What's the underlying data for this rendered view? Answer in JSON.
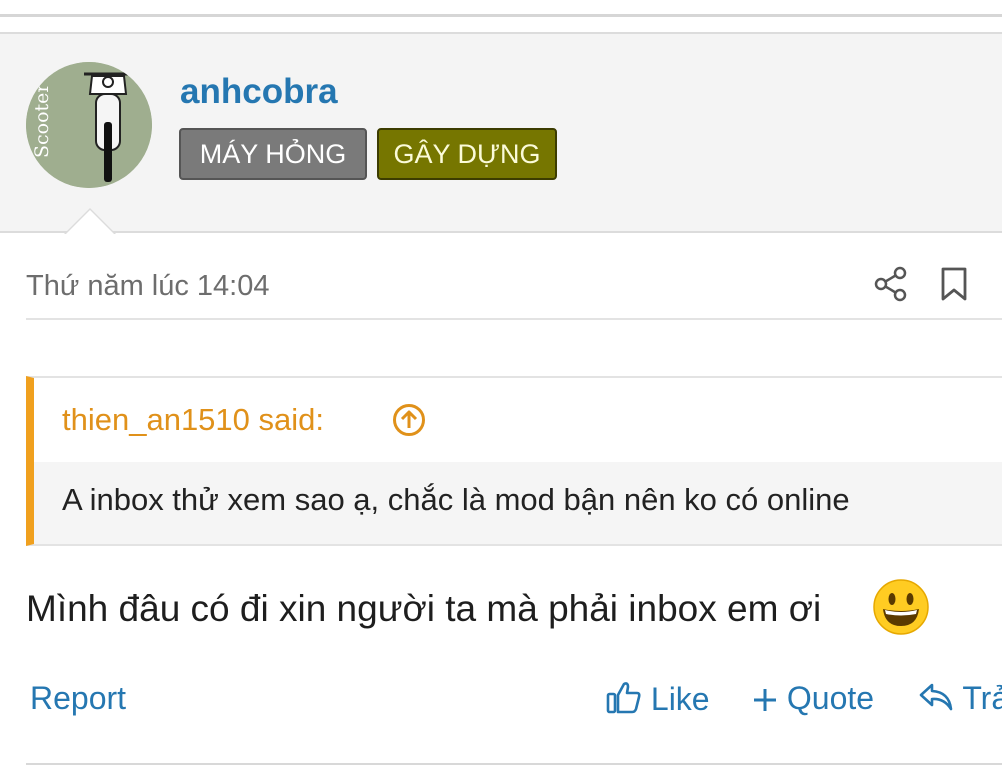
{
  "post": {
    "username": "anhcobra",
    "avatar_text": "Scooter",
    "badges": [
      "MÁY HỎNG",
      "GÂY DỰNG"
    ],
    "timestamp": "Thứ năm lúc 14:04",
    "quote": {
      "author": "thien_an1510 said:",
      "text": "A inbox thử xem sao ạ, chắc là mod bận nên ko có online"
    },
    "message": "Mình đâu có đi xin người ta mà phải inbox em ơi",
    "emoji": "grinning-face-emoji"
  },
  "actions": {
    "report": "Report",
    "like": "Like",
    "quote": "Quote",
    "reply": "Trả"
  },
  "colors": {
    "link": "#2577b1",
    "quote_accent": "#f0a01e",
    "badge_gray": "#7a7a7a",
    "badge_olive": "#767600"
  }
}
